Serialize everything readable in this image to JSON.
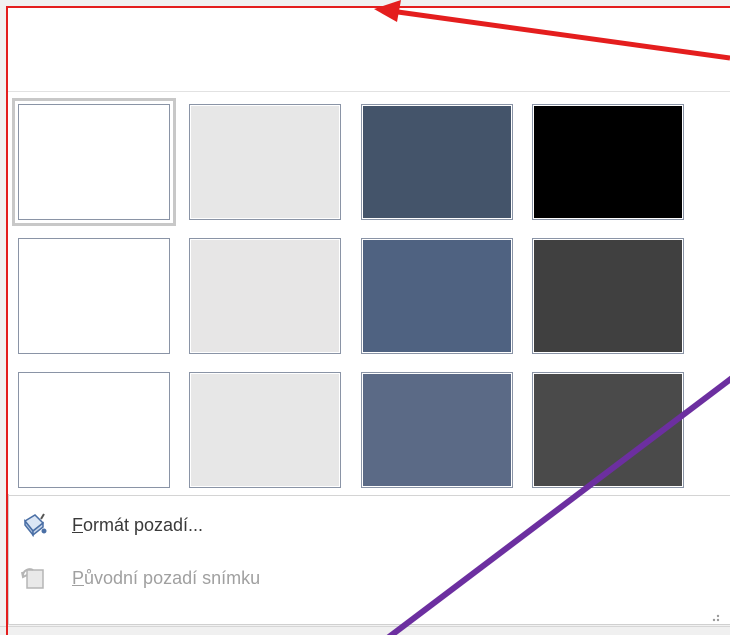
{
  "gallery": {
    "rows": [
      [
        {
          "color": "#ffffff",
          "selected": true
        },
        {
          "color": "#e7e7e7",
          "selected": false
        },
        {
          "color": "#44546a",
          "selected": false
        },
        {
          "color": "#000000",
          "selected": false
        }
      ],
      [
        {
          "color": "#ffffff",
          "selected": false
        },
        {
          "color": "#e7e6e6",
          "selected": false
        },
        {
          "color": "#4f6281",
          "selected": false
        },
        {
          "color": "#404040",
          "selected": false
        }
      ],
      [
        {
          "color": "#ffffff",
          "selected": false
        },
        {
          "color": "#e7e7e7",
          "selected": false
        },
        {
          "color": "#5b6a86",
          "selected": false
        },
        {
          "color": "#4a4a4a",
          "selected": false
        }
      ]
    ]
  },
  "menu": {
    "format_background": {
      "mnemonic": "F",
      "rest": "ormát pozadí...",
      "icon": "format-background-icon",
      "enabled": true
    },
    "reset_background": {
      "mnemonic": "P",
      "rest": "ůvodní pozadí snímku",
      "icon": "reset-background-icon",
      "enabled": false
    }
  },
  "annotation_colors": {
    "red": "#e41e1e",
    "purple": "#6c2fa0"
  }
}
